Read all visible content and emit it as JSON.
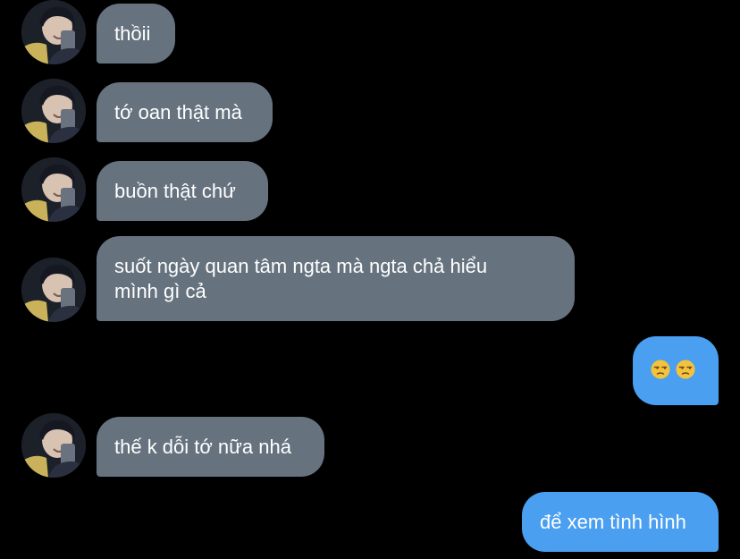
{
  "conversation": {
    "messages": [
      {
        "side": "incoming",
        "text": "thồii"
      },
      {
        "side": "incoming",
        "text": "tớ oan thật mà"
      },
      {
        "side": "incoming",
        "text": "buồn thật chứ"
      },
      {
        "side": "incoming",
        "text": "suốt ngày quan tâm ngta mà ngta chả hiểu\nmình gì cả"
      },
      {
        "side": "outgoing",
        "emoji": [
          "unamused-face",
          "unamused-face"
        ],
        "text": "😒 😒"
      },
      {
        "side": "incoming",
        "text": "thế k dỗi tớ nữa nhá"
      },
      {
        "side": "outgoing",
        "text": "để xem tình hình"
      }
    ],
    "colors": {
      "background": "#000000",
      "incoming_bubble": "#66737f",
      "outgoing_bubble": "#4a9ff0",
      "text": "#ffffff"
    }
  }
}
